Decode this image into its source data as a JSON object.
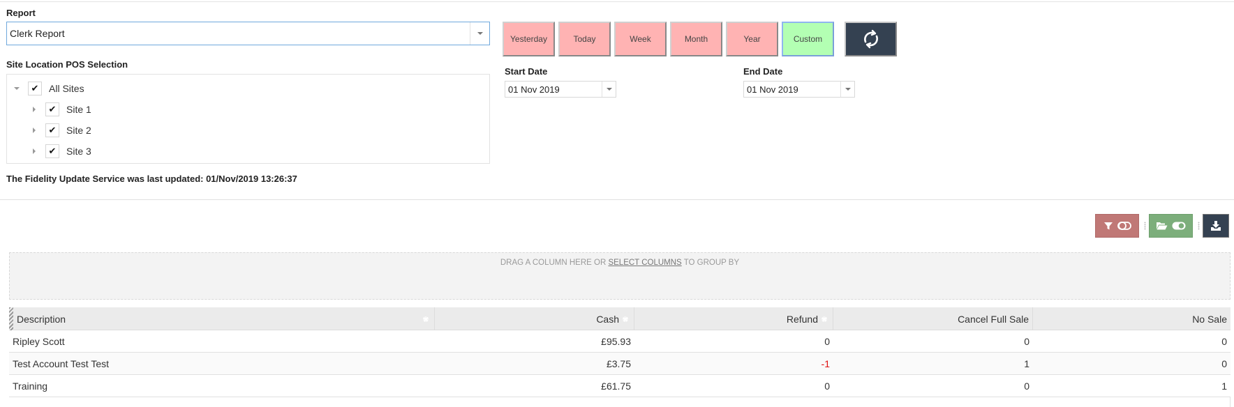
{
  "report": {
    "label": "Report",
    "selected": "Clerk Report"
  },
  "sites": {
    "label": "Site Location POS Selection",
    "root": {
      "label": "All Sites",
      "checked": true,
      "expanded": true
    },
    "children": [
      {
        "label": "Site 1",
        "checked": true
      },
      {
        "label": "Site 2",
        "checked": true
      },
      {
        "label": "Site 3",
        "checked": true
      }
    ]
  },
  "status": {
    "text": "The Fidelity Update Service was last updated: 01/Nov/2019 13:26:37"
  },
  "periods": {
    "buttons": [
      {
        "label": "Yesterday",
        "active": false
      },
      {
        "label": "Today",
        "active": false
      },
      {
        "label": "Week",
        "active": false
      },
      {
        "label": "Month",
        "active": false
      },
      {
        "label": "Year",
        "active": false
      },
      {
        "label": "Custom",
        "active": true
      }
    ],
    "refresh_icon": "refresh-icon"
  },
  "dates": {
    "start_label": "Start Date",
    "start_value": "01 Nov 2019",
    "end_label": "End Date",
    "end_value": "01 Nov 2019"
  },
  "toolbar": {
    "filter_icon": "filter-toggle-icon",
    "folder_icon": "folder-toggle-icon",
    "export_icon": "download-icon"
  },
  "group_panel": {
    "prefix": "DRAG A COLUMN HERE OR ",
    "link": "SELECT COLUMNS",
    "suffix": " TO GROUP BY"
  },
  "grid": {
    "columns": [
      "Description",
      "Cash",
      "Refund",
      "Cancel Full Sale",
      "No Sale"
    ],
    "rows": [
      [
        "Ripley Scott",
        "£95.93",
        "0",
        "0",
        "0"
      ],
      [
        "Test Account Test Test",
        "£3.75",
        "-1",
        "1",
        "0"
      ],
      [
        "Training",
        "£61.75",
        "0",
        "0",
        "1"
      ]
    ]
  }
}
